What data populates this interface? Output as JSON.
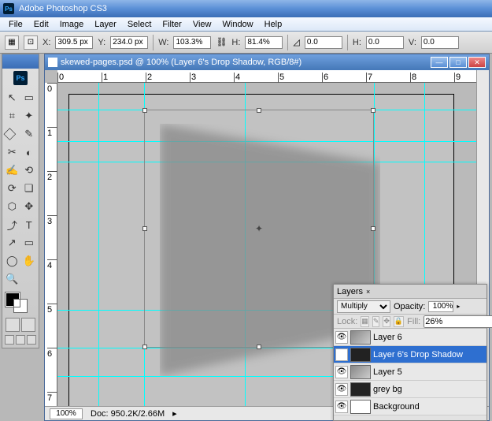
{
  "app": {
    "title": "Adobe Photoshop CS3"
  },
  "menu": [
    "File",
    "Edit",
    "Image",
    "Layer",
    "Select",
    "Filter",
    "View",
    "Window",
    "Help"
  ],
  "options": {
    "x_label": "X:",
    "x": "309.5 px",
    "y_label": "Y:",
    "y": "234.0 px",
    "w_label": "W:",
    "w": "103.3%",
    "h_label": "H:",
    "h": "81.4%",
    "rot_label": "",
    "rot": "0.0",
    "hskew_label": "H:",
    "hskew": "0.0",
    "vskew_label": "V:",
    "vskew": "0.0"
  },
  "doc": {
    "title": "skewed-pages.psd @ 100% (Layer 6's Drop Shadow, RGB/8#)"
  },
  "ruler_h": [
    "0",
    "1",
    "2",
    "3",
    "4",
    "5",
    "6",
    "7",
    "8",
    "9"
  ],
  "ruler_v": [
    "0",
    "1",
    "2",
    "3",
    "4",
    "5",
    "6",
    "7"
  ],
  "status": {
    "zoom": "100%",
    "doc": "Doc: 950.2K/2.66M"
  },
  "layers": {
    "tab": "Layers",
    "blend": "Multiply",
    "blend_options": [
      "Multiply"
    ],
    "opacity_label": "Opacity:",
    "opacity": "100%",
    "lock_label": "Lock:",
    "fill_label": "Fill:",
    "fill": "26%",
    "items": [
      {
        "name": "Layer 6",
        "sel": false,
        "thumb": "gr"
      },
      {
        "name": "Layer 6's Drop Shadow",
        "sel": true,
        "thumb": "dk"
      },
      {
        "name": "Layer 5",
        "sel": false,
        "thumb": "gr"
      },
      {
        "name": "grey bg",
        "sel": false,
        "thumb": "dk"
      },
      {
        "name": "Background",
        "sel": false,
        "thumb": ""
      }
    ]
  },
  "tools": [
    "↖",
    "▭",
    "⌗",
    "✦",
    "⃟",
    "✎",
    "✂",
    "◐",
    "✍",
    "⟲",
    "⟳",
    "❏",
    "⬡",
    "✥",
    "⤴",
    "T",
    "↗",
    "▭",
    "◯",
    "✋",
    "🔍"
  ]
}
